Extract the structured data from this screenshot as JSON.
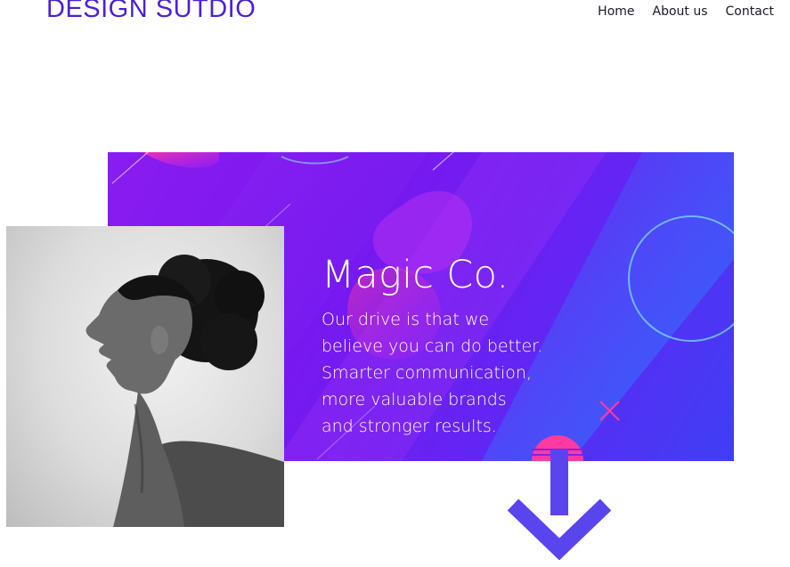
{
  "header": {
    "logo_text": "DESIGN SUTDIO",
    "nav": [
      {
        "label": "Home"
      },
      {
        "label": "About us"
      },
      {
        "label": "Contact"
      }
    ]
  },
  "hero": {
    "title": "Magic Co.",
    "body_lines": [
      "Our drive is that we",
      "believe you can do better.",
      "Smarter communication,",
      "more valuable brands",
      "and stronger results."
    ]
  },
  "portrait": {
    "subject": "black-and-white profile portrait of a woman"
  },
  "scroll_down": {
    "icon": "arrow-down-icon",
    "color": "#5a44ee"
  },
  "colors": {
    "brand": "#4b1fd8",
    "hero_start": "#8a1cf0",
    "hero_end": "#3f3ff5",
    "accent_pink": "#ff3aa0"
  }
}
